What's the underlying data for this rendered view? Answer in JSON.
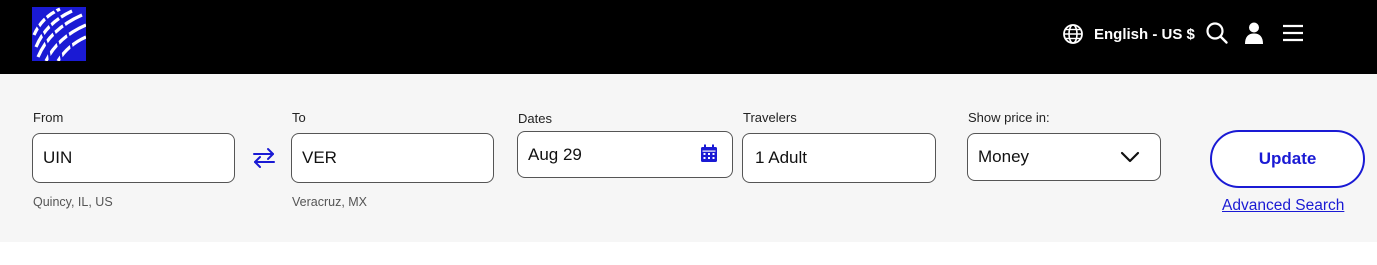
{
  "header": {
    "logo": "globe-logo-icon",
    "language_label": "English - US $",
    "icons": [
      "globe-icon",
      "search-icon",
      "user-icon",
      "menu-icon"
    ]
  },
  "search": {
    "from": {
      "label": "From",
      "value": "UIN",
      "subtext": "Quincy, IL, US"
    },
    "to": {
      "label": "To",
      "value": "VER",
      "subtext": "Veracruz, MX"
    },
    "dates": {
      "label": "Dates",
      "value": "Aug 29"
    },
    "travelers": {
      "label": "Travelers",
      "value": "1 Adult"
    },
    "price": {
      "label": "Show price in:",
      "value": "Money"
    },
    "update_label": "Update",
    "advanced_label": "Advanced Search"
  },
  "colors": {
    "header_bg": "#000000",
    "accent": "#1a1ad4",
    "panel_bg": "#f6f6f6"
  }
}
